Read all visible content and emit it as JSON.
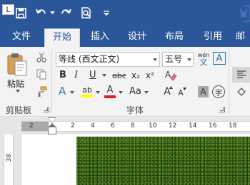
{
  "quick_access": {
    "save_icon": "save-icon",
    "undo_icon": "undo-icon",
    "redo_icon": "redo-icon",
    "print_preview_icon": "print-preview-icon",
    "customize_icon": "customize-dropdown-icon"
  },
  "tabs": [
    {
      "label": "文件"
    },
    {
      "label": "开始",
      "active": true
    },
    {
      "label": "插入"
    },
    {
      "label": "设计"
    },
    {
      "label": "布局"
    },
    {
      "label": "引用"
    },
    {
      "label": "邮"
    }
  ],
  "clipboard": {
    "paste_label": "粘贴",
    "group_label": "剪贴板"
  },
  "font": {
    "font_name": "等线 (西文正文)",
    "font_size": "五号",
    "wen_label": "wén",
    "wen_char": "文",
    "border_char": "A",
    "bold": "B",
    "italic": "I",
    "underline": "U",
    "strike": "abc",
    "subscript": "x₂",
    "superscript": "x²",
    "text_effects": "A",
    "highlight": "ab",
    "font_color": "A",
    "change_case": "Aa",
    "grow_font": "A",
    "shrink_font": "A",
    "char_shading": "A",
    "enclose_char": "字",
    "group_label": "字体"
  },
  "ruler": {
    "tab_selector": "L",
    "numbers": [
      "2",
      "2",
      "4",
      "6",
      "8",
      "10",
      "12",
      "14",
      "16",
      "18"
    ],
    "vertical_number": "38"
  },
  "colors": {
    "brand": "#2b579a",
    "ribbon_bg": "#f3f3f3",
    "font_color_bar": "#e02020",
    "highlight_bar": "#ffff00",
    "text_effect_blue": "#2e75b6"
  }
}
